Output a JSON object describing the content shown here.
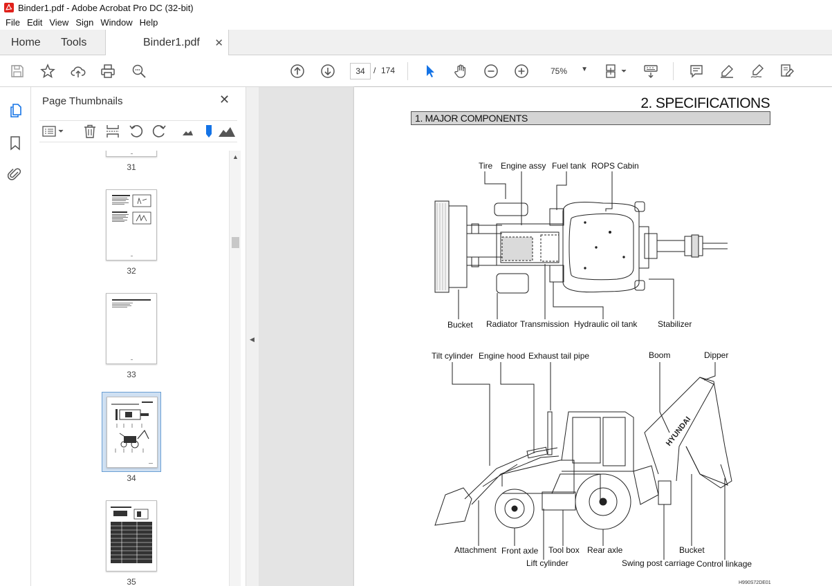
{
  "window": {
    "title": "Binder1.pdf - Adobe Acrobat Pro DC (32-bit)"
  },
  "menu": {
    "items": [
      "File",
      "Edit",
      "View",
      "Sign",
      "Window",
      "Help"
    ]
  },
  "tabs": {
    "home": "Home",
    "tools": "Tools",
    "document": "Binder1.pdf"
  },
  "toolbar": {
    "current_page": "34",
    "separator": "/",
    "total_pages": "174",
    "zoom": "75%"
  },
  "icons": {
    "save": "save-icon",
    "bookmark": "star-icon",
    "upload": "cloud-upload-icon",
    "print": "print-icon",
    "find": "magnifier-icon",
    "prev": "arrow-up-circle-icon",
    "next": "arrow-down-circle-icon",
    "select": "cursor-arrow-icon",
    "hand": "hand-icon",
    "zoom_out": "zoom-out-icon",
    "zoom_in": "zoom-in-icon",
    "fit": "page-fit-icon",
    "keyboard": "scrolling-mode-icon",
    "comment": "comment-icon",
    "highlight": "highlight-pen-icon",
    "sign": "sign-pen-icon",
    "fill": "fill-sign-icon"
  },
  "sidebar": {
    "title": "Page Thumbnails",
    "thumbnails": [
      {
        "label": "31"
      },
      {
        "label": "32"
      },
      {
        "label": "33"
      },
      {
        "label": "34"
      },
      {
        "label": "35"
      }
    ]
  },
  "page": {
    "heading": "2. SPECIFICATIONS",
    "section": "1. MAJOR COMPONENTS",
    "top_labels": [
      "Tire",
      "Engine assy",
      "Fuel tank",
      "ROPS Cabin",
      "Bucket",
      "Radiator",
      "Transmission",
      "Hydraulic oil tank",
      "Stabilizer"
    ],
    "side_labels": [
      "Tilt cylinder",
      "Engine hood",
      "Exhaust tail pipe",
      "Boom",
      "Dipper",
      "Attachment",
      "Front axle",
      "Lift cylinder",
      "Tool box",
      "Rear axle",
      "Swing post carriage",
      "Bucket",
      "Control linkage"
    ],
    "code": "H990S72DE01"
  },
  "colors": {
    "accent": "#1473e6",
    "selection": "#cfe0f2",
    "pdf_red": "#e0211b"
  }
}
